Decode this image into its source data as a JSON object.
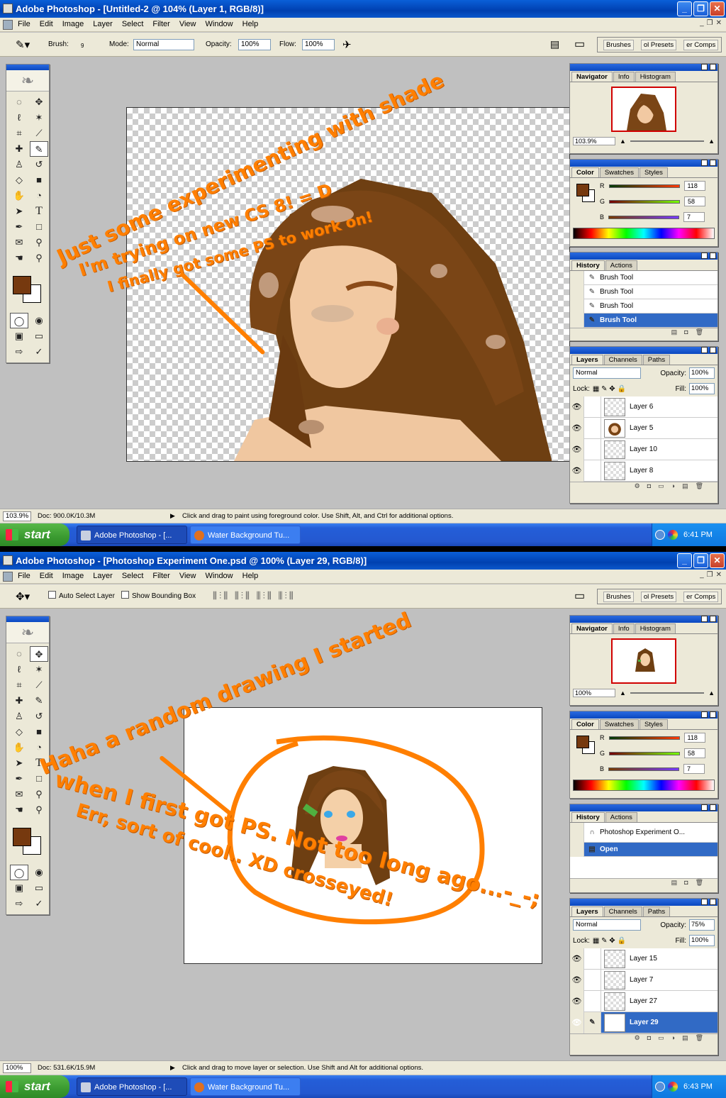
{
  "shots": [
    {
      "title": "Adobe Photoshop - [Untitled-2 @ 104% (Layer 1, RGB/8)]",
      "menu": [
        "File",
        "Edit",
        "Image",
        "Layer",
        "Select",
        "Filter",
        "View",
        "Window",
        "Help"
      ],
      "options": {
        "brush_label": "Brush:",
        "brush_size": "9",
        "mode_label": "Mode:",
        "mode_value": "Normal",
        "opacity_label": "Opacity:",
        "opacity_value": "100%",
        "flow_label": "Flow:",
        "flow_value": "100%"
      },
      "wells": [
        "Brushes",
        "ol Presets",
        "er Comps"
      ],
      "annotation": [
        "Just some experimenting with shade",
        "I'm trying on new CS 8! = D",
        "I finally got some PS to work on!"
      ],
      "navigator": {
        "tabs": [
          "Navigator",
          "Info",
          "Histogram"
        ],
        "zoom": "103.9%"
      },
      "color": {
        "tabs": [
          "Color",
          "Swatches",
          "Styles"
        ],
        "r": "118",
        "g": "58",
        "b": "7",
        "fg": "#76390f"
      },
      "history": {
        "tabs": [
          "History",
          "Actions"
        ],
        "items": [
          "Brush Tool",
          "Brush Tool",
          "Brush Tool",
          "Brush Tool"
        ]
      },
      "layers": {
        "tabs": [
          "Layers",
          "Channels",
          "Paths"
        ],
        "blend": "Normal",
        "opacity_label": "Opacity:",
        "opacity": "100%",
        "lock_label": "Lock:",
        "fill_label": "Fill:",
        "fill": "100%",
        "items": [
          "Layer 6",
          "Layer 5",
          "Layer 10",
          "Layer 8"
        ]
      },
      "status": {
        "zoom": "103.9%",
        "doc": "Doc: 900.0K/10.3M",
        "hint": "Click and drag to paint using foreground color.  Use Shift, Alt, and Ctrl for additional options."
      },
      "taskbar": {
        "start": "start",
        "tasks": [
          "Adobe Photoshop - [...",
          "Water Background Tu..."
        ],
        "time": "6:41 PM"
      }
    },
    {
      "title": "Adobe Photoshop - [Photoshop Experiment One.psd @ 100% (Layer 29, RGB/8)]",
      "menu": [
        "File",
        "Edit",
        "Image",
        "Layer",
        "Select",
        "Filter",
        "View",
        "Window",
        "Help"
      ],
      "options": {
        "auto_select": "Auto Select Layer",
        "bounding_box": "Show Bounding Box"
      },
      "wells": [
        "Brushes",
        "ol Presets",
        "er Comps"
      ],
      "annotation": [
        "Haha a random drawing I started",
        "when I first got PS. Not too long ago...-_-;",
        "Err, sort of cool.. XD crosseyed!"
      ],
      "navigator": {
        "tabs": [
          "Navigator",
          "Info",
          "Histogram"
        ],
        "zoom": "100%"
      },
      "color": {
        "tabs": [
          "Color",
          "Swatches",
          "Styles"
        ],
        "r": "118",
        "g": "58",
        "b": "7",
        "fg": "#76390f"
      },
      "history": {
        "tabs": [
          "History",
          "Actions"
        ],
        "items": [
          "Photoshop Experiment O...",
          "Open"
        ]
      },
      "layers": {
        "tabs": [
          "Layers",
          "Channels",
          "Paths"
        ],
        "blend": "Normal",
        "opacity_label": "Opacity:",
        "opacity": "75%",
        "lock_label": "Lock:",
        "fill_label": "Fill:",
        "fill": "100%",
        "items": [
          "Layer 15",
          "Layer 7",
          "Layer 27",
          "Layer 29"
        ]
      },
      "status": {
        "zoom": "100%",
        "doc": "Doc: 531.6K/15.9M",
        "hint": "Click and drag to move layer or selection.  Use Shift and Alt for additional options."
      },
      "taskbar": {
        "start": "start",
        "tasks": [
          "Adobe Photoshop - [...",
          "Water Background Tu..."
        ],
        "time": "6:43 PM"
      }
    }
  ],
  "icons": {
    "brush": "brush-icon",
    "move": "move-icon",
    "eye": "eye-icon"
  },
  "colors": {
    "annotation": "#ff7f00",
    "xp_blue": "#0a48c0",
    "selection": "#316ac5"
  }
}
